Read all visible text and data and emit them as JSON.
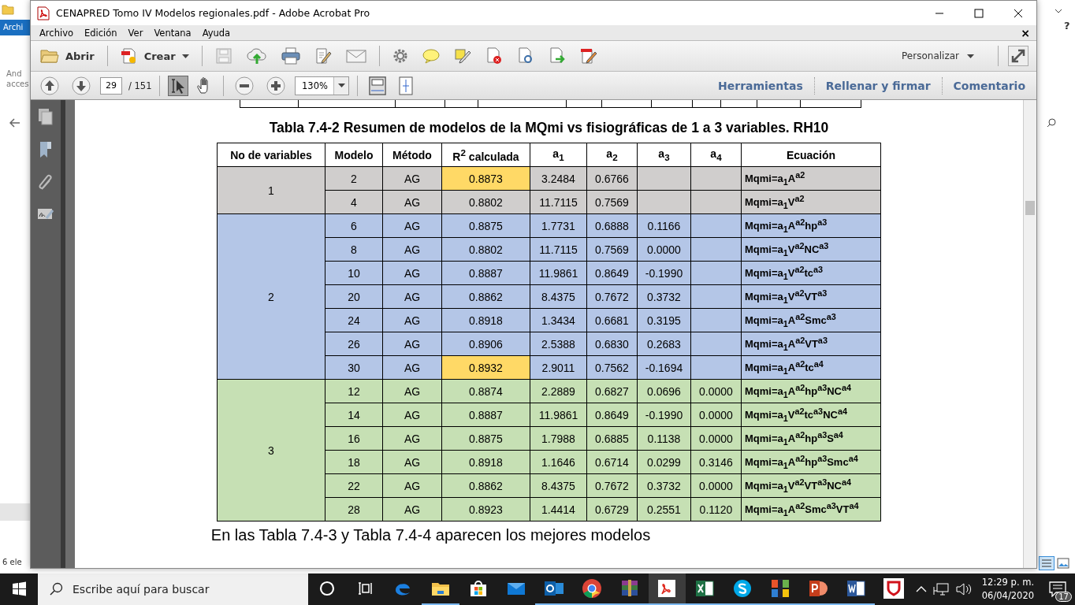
{
  "explorer": {
    "ribbon_tab": "Archi",
    "ribbon_label_1": "And",
    "ribbon_label_2": "acces",
    "status": "6 ele",
    "help": "?"
  },
  "window": {
    "title": "CENAPRED Tomo IV Modelos regionales.pdf - Adobe Acrobat Pro"
  },
  "menu": [
    "Archivo",
    "Edición",
    "Ver",
    "Ventana",
    "Ayuda"
  ],
  "doc_close": "×",
  "toolbar": {
    "open": "Abrir",
    "create": "Crear",
    "customize": "Personalizar"
  },
  "nav": {
    "page": "29",
    "page_count": "/ 151",
    "zoom": "130%",
    "tools": [
      {
        "kind": "select",
        "selected": true
      },
      {
        "kind": "hand",
        "selected": false
      }
    ],
    "links": [
      "Herramientas",
      "Rellenar y firmar",
      "Comentario"
    ]
  },
  "document": {
    "title": "Tabla 7.4-2 Resumen de modelos de la MQmi vs fisiográficas de 1 a 3 variables. RH10",
    "table": {
      "columns": [
        "No de variables",
        "Modelo",
        "Método",
        "R$^{2}$ calculada",
        "a$_{1}$",
        "a$_{2}$",
        "a$_{3}$",
        "a$_{4}$",
        "Ecuación"
      ],
      "groups": [
        {
          "variables": "1",
          "color": "#d0cecd",
          "rows": [
            {
              "model": "2",
              "method": "AG",
              "r2": "0.8873",
              "highlighted": true,
              "a1": "3.2484",
              "a2": "0.6766",
              "equation": "Mqmi=a$_{1}$A$^{a2}$"
            },
            {
              "model": "4",
              "method": "AG",
              "r2": "0.8802",
              "highlighted": false,
              "a1": "11.7115",
              "a2": "0.7569",
              "equation": "Mqmi=a$_{1}$V$^{a2}$"
            }
          ]
        },
        {
          "variables": "2",
          "color": "#b4c6e7",
          "rows": [
            {
              "model": "6",
              "method": "AG",
              "r2": "0.8875",
              "highlighted": false,
              "a1": "1.7731",
              "a2": "0.6888",
              "a3": "0.1166",
              "equation": "Mqmi=a$_{1}$A$^{a2}$hp$^{a3}$"
            },
            {
              "model": "8",
              "method": "AG",
              "r2": "0.8802",
              "highlighted": false,
              "a1": "11.7115",
              "a2": "0.7569",
              "a3": "0.0000",
              "equation": "Mqmi=a$_{1}$V$^{a2}$NC$^{a3}$"
            },
            {
              "model": "10",
              "method": "AG",
              "r2": "0.8887",
              "highlighted": false,
              "a1": "11.9861",
              "a2": "0.8649",
              "a3": "-0.1990",
              "equation": "Mqmi=a$_{1}$V$^{a2}$tc$^{a3}$"
            },
            {
              "model": "20",
              "method": "AG",
              "r2": "0.8862",
              "highlighted": false,
              "a1": "8.4375",
              "a2": "0.7672",
              "a3": "0.3732",
              "equation": "Mqmi=a$_{1}$V$^{a2}$VT$^{a3}$"
            },
            {
              "model": "24",
              "method": "AG",
              "r2": "0.8918",
              "highlighted": false,
              "a1": "1.3434",
              "a2": "0.6681",
              "a3": "0.3195",
              "equation": "Mqmi=a$_{1}$A$^{a2}$Smc$^{a3}$"
            },
            {
              "model": "26",
              "method": "AG",
              "r2": "0.8906",
              "highlighted": false,
              "a1": "2.5388",
              "a2": "0.6830",
              "a3": "0.2683",
              "equation": "Mqmi=a$_{1}$A$^{a2}$VT$^{a3}$"
            },
            {
              "model": "30",
              "method": "AG",
              "r2": "0.8932",
              "highlighted": true,
              "a1": "2.9011",
              "a2": "0.7562",
              "a3": "-0.1694",
              "equation": "Mqmi=a$_{1}$A$^{a2}$tc$^{a4}$"
            }
          ]
        },
        {
          "variables": "3",
          "color": "#c6e0b4",
          "rows": [
            {
              "model": "12",
              "method": "AG",
              "r2": "0.8874",
              "highlighted": false,
              "a1": "2.2889",
              "a2": "0.6827",
              "a3": "0.0696",
              "a4": "0.0000",
              "equation": "Mqmi=a$_{1}$A$^{a2}$hp$^{a3}$NC$^{a4}$"
            },
            {
              "model": "14",
              "method": "AG",
              "r2": "0.8887",
              "highlighted": false,
              "a1": "11.9861",
              "a2": "0.8649",
              "a3": "-0.1990",
              "a4": "0.0000",
              "equation": "Mqmi=a$_{1}$V$^{a2}$tc$^{a3}$NC$^{a4}$"
            },
            {
              "model": "16",
              "method": "AG",
              "r2": "0.8875",
              "highlighted": false,
              "a1": "1.7988",
              "a2": "0.6885",
              "a3": "0.1138",
              "a4": "0.0000",
              "equation": "Mqmi=a$_{1}$A$^{a2}$hp$^{a3}$S$^{a4}$"
            },
            {
              "model": "18",
              "method": "AG",
              "r2": "0.8918",
              "highlighted": false,
              "a1": "1.1646",
              "a2": "0.6714",
              "a3": "0.0299",
              "a4": "0.3146",
              "equation": "Mqmi=a$_{1}$A$^{a2}$hp$^{a3}$Smc$^{a4}$"
            },
            {
              "model": "22",
              "method": "AG",
              "r2": "0.8862",
              "highlighted": false,
              "a1": "8.4375",
              "a2": "0.7672",
              "a3": "0.3732",
              "a4": "0.0000",
              "equation": "Mqmi=a$_{1}$V$^{a2}$VT$^{a3}$NC$^{a4}$"
            },
            {
              "model": "28",
              "method": "AG",
              "r2": "0.8923",
              "highlighted": false,
              "a1": "1.4414",
              "a2": "0.6729",
              "a3": "0.2551",
              "a4": "0.1120",
              "equation": "Mqmi=a$_{1}$A$^{a2}$Smc$^{a3}$VT$^{a4}$"
            }
          ]
        }
      ]
    },
    "paragraph": "En las Tabla 7.4-3 y Tabla 7.4-4 aparecen los mejores modelos"
  },
  "taskbar": {
    "search_placeholder": "Escribe aquí para buscar",
    "apps": [
      {
        "kind": "cortana",
        "running": false,
        "active": false
      },
      {
        "kind": "taskview",
        "running": false,
        "active": false
      },
      {
        "kind": "edge",
        "running": false,
        "active": false
      },
      {
        "kind": "explorer",
        "running": true,
        "active": false
      },
      {
        "kind": "store",
        "running": false,
        "active": false
      },
      {
        "kind": "mail",
        "running": false,
        "active": false
      },
      {
        "kind": "outlook",
        "running": true,
        "active": false
      },
      {
        "kind": "chrome",
        "running": true,
        "active": false
      },
      {
        "kind": "winrar",
        "running": true,
        "active": false
      },
      {
        "kind": "acrobat",
        "running": true,
        "active": true
      },
      {
        "kind": "excel",
        "running": true,
        "active": false
      },
      {
        "kind": "skype",
        "running": true,
        "active": false
      },
      {
        "kind": "tiles",
        "running": true,
        "active": false
      },
      {
        "kind": "powerpoint",
        "running": true,
        "active": false
      },
      {
        "kind": "word",
        "running": true,
        "active": false
      },
      {
        "kind": "shield",
        "running": false,
        "active": false
      }
    ],
    "time": "12:29 p. m.",
    "date": "06/04/2020",
    "notifications": "17"
  }
}
